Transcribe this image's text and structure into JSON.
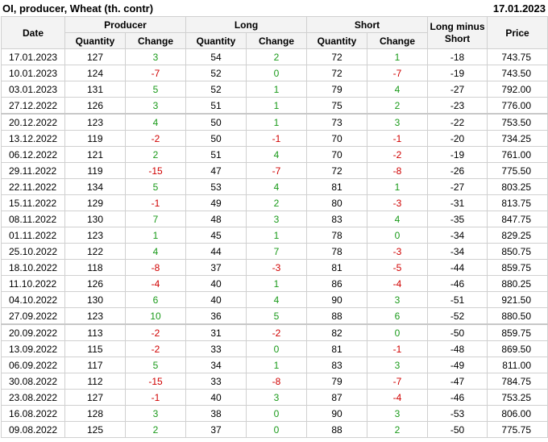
{
  "title": "OI, producer, Wheat (th. contr)",
  "date": "17.01.2023",
  "headers": {
    "date": "Date",
    "producer": "Producer",
    "long": "Long",
    "short": "Short",
    "long_minus_short": "Long minus Short",
    "price": "Price",
    "quantity": "Quantity",
    "change": "Change"
  },
  "rows": [
    [
      "17.01.2023",
      "127",
      "3",
      "54",
      "2",
      "72",
      "1",
      "-18",
      "743.75"
    ],
    [
      "10.01.2023",
      "124",
      "-7",
      "52",
      "0",
      "72",
      "-7",
      "-19",
      "743.50"
    ],
    [
      "03.01.2023",
      "131",
      "5",
      "52",
      "1",
      "79",
      "4",
      "-27",
      "792.00"
    ],
    [
      "27.12.2022",
      "126",
      "3",
      "51",
      "1",
      "75",
      "2",
      "-23",
      "776.00"
    ],
    [
      "20.12.2022",
      "123",
      "4",
      "50",
      "1",
      "73",
      "3",
      "-22",
      "753.50"
    ],
    [
      "13.12.2022",
      "119",
      "-2",
      "50",
      "-1",
      "70",
      "-1",
      "-20",
      "734.25"
    ],
    [
      "06.12.2022",
      "121",
      "2",
      "51",
      "4",
      "70",
      "-2",
      "-19",
      "761.00"
    ],
    [
      "29.11.2022",
      "119",
      "-15",
      "47",
      "-7",
      "72",
      "-8",
      "-26",
      "775.50"
    ],
    [
      "22.11.2022",
      "134",
      "5",
      "53",
      "4",
      "81",
      "1",
      "-27",
      "803.25"
    ],
    [
      "15.11.2022",
      "129",
      "-1",
      "49",
      "2",
      "80",
      "-3",
      "-31",
      "813.75"
    ],
    [
      "08.11.2022",
      "130",
      "7",
      "48",
      "3",
      "83",
      "4",
      "-35",
      "847.75"
    ],
    [
      "01.11.2022",
      "123",
      "1",
      "45",
      "1",
      "78",
      "0",
      "-34",
      "829.25"
    ],
    [
      "25.10.2022",
      "122",
      "4",
      "44",
      "7",
      "78",
      "-3",
      "-34",
      "850.75"
    ],
    [
      "18.10.2022",
      "118",
      "-8",
      "37",
      "-3",
      "81",
      "-5",
      "-44",
      "859.75"
    ],
    [
      "11.10.2022",
      "126",
      "-4",
      "40",
      "1",
      "86",
      "-4",
      "-46",
      "880.25"
    ],
    [
      "04.10.2022",
      "130",
      "6",
      "40",
      "4",
      "90",
      "3",
      "-51",
      "921.50"
    ],
    [
      "27.09.2022",
      "123",
      "10",
      "36",
      "5",
      "88",
      "6",
      "-52",
      "880.50"
    ],
    [
      "20.09.2022",
      "113",
      "-2",
      "31",
      "-2",
      "82",
      "0",
      "-50",
      "859.75"
    ],
    [
      "13.09.2022",
      "115",
      "-2",
      "33",
      "0",
      "81",
      "-1",
      "-48",
      "869.50"
    ],
    [
      "06.09.2022",
      "117",
      "5",
      "34",
      "1",
      "83",
      "3",
      "-49",
      "811.00"
    ],
    [
      "30.08.2022",
      "112",
      "-15",
      "33",
      "-8",
      "79",
      "-7",
      "-47",
      "784.75"
    ],
    [
      "23.08.2022",
      "127",
      "-1",
      "40",
      "3",
      "87",
      "-4",
      "-46",
      "753.25"
    ],
    [
      "16.08.2022",
      "128",
      "3",
      "38",
      "0",
      "90",
      "3",
      "-53",
      "806.00"
    ],
    [
      "09.08.2022",
      "125",
      "2",
      "37",
      "0",
      "88",
      "2",
      "-50",
      "775.75"
    ]
  ],
  "separator_before_rows": [
    4,
    17
  ],
  "colors": {
    "positive": "#1a9a1a",
    "negative": "#d00000"
  }
}
